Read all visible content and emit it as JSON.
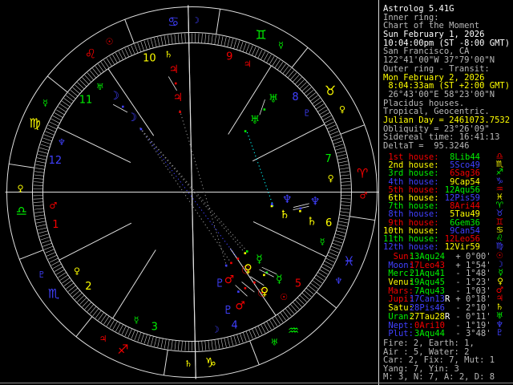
{
  "app_title": "Astrolog 5.41G",
  "colors": {
    "red": "#f40000",
    "yellow": "#ffff00",
    "green": "#00f000",
    "blue": "#4040ff",
    "cyan": "#00ffff",
    "gray": "#b8b8b8",
    "white": "#ffffff",
    "wheel_line": "#e0e0e0",
    "tick": "#c8c8c8",
    "aspect_gray": "#8f8f8f",
    "leader": "#e8e8e8"
  },
  "panel": {
    "info_lines": [
      {
        "text": "Astrolog 5.41G",
        "color": "white"
      },
      {
        "text": "Inner ring:",
        "color": "gray"
      },
      {
        "text": "Chart of the Moment",
        "color": "gray"
      },
      {
        "text": "Sun February 1, 2026",
        "color": "white"
      },
      {
        "text": "10:04:00pm (ST -8:00 GMT)",
        "color": "white"
      },
      {
        "text": "San Francisco, CA",
        "color": "gray"
      },
      {
        "text": "122°41'00\"W 37°79'00\"N",
        "color": "gray"
      },
      {
        "text": "Outer ring - Transit:",
        "color": "gray"
      },
      {
        "text": "Mon February 2, 2026",
        "color": "yellow"
      },
      {
        "text": " 8:04:33am (ST +2:00 GMT)",
        "color": "yellow"
      },
      {
        "text": " 26°43'00\"E 58°23'00\"N",
        "color": "gray"
      },
      {
        "text": "Placidus houses.",
        "color": "gray"
      },
      {
        "text": "Tropical, Geocentric.",
        "color": "gray"
      },
      {
        "text": "Julian Day = 2461073.7532",
        "color": "yellow"
      },
      {
        "text": "Obliquity = 23°26'09\"",
        "color": "gray"
      },
      {
        "text": "Sidereal time: 16:41:13",
        "color": "gray"
      },
      {
        "text": "DeltaT =  95.3246",
        "color": "gray"
      }
    ],
    "stats_lines": [
      "Fire: 2, Earth: 1,",
      "Air : 5, Water: 2",
      "Car: 2, Fix: 7, Mut: 1",
      "Yang: 7, Yin: 3",
      "M: 3, N: 7, A: 2, D: 8"
    ]
  },
  "houses": [
    {
      "num": "1",
      "label": " 1st house:",
      "value": "8Lib44",
      "lon": 188.73,
      "sign_glyph": "♎",
      "label_color": "red",
      "value_color": "green",
      "glyph_color": "red",
      "natural_ruler": "♂",
      "ruler_color": "red"
    },
    {
      "num": "2",
      "label": " 2nd house:",
      "value": "5Sco49",
      "lon": 215.82,
      "sign_glyph": "♏",
      "label_color": "yellow",
      "value_color": "blue",
      "glyph_color": "yellow",
      "natural_ruler": "♀",
      "ruler_color": "yellow"
    },
    {
      "num": "3",
      "label": " 3rd house:",
      "value": "6Sag36",
      "lon": 246.6,
      "sign_glyph": "♐",
      "label_color": "green",
      "value_color": "red",
      "glyph_color": "green",
      "natural_ruler": "☿",
      "ruler_color": "green"
    },
    {
      "num": "4",
      "label": " 4th house:",
      "value": "9Cap54",
      "lon": 279.9,
      "sign_glyph": "♑",
      "label_color": "blue",
      "value_color": "yellow",
      "glyph_color": "blue",
      "natural_ruler": "☽",
      "ruler_color": "blue"
    },
    {
      "num": "5",
      "label": " 5th house:",
      "value": "12Aqu56",
      "lon": 312.93,
      "sign_glyph": "♒",
      "label_color": "red",
      "value_color": "green",
      "glyph_color": "red",
      "natural_ruler": "☉",
      "ruler_color": "red"
    },
    {
      "num": "6",
      "label": " 6th house:",
      "value": "12Pis59",
      "lon": 342.98,
      "sign_glyph": "♓",
      "label_color": "yellow",
      "value_color": "blue",
      "glyph_color": "yellow",
      "natural_ruler": "☿",
      "ruler_color": "green"
    },
    {
      "num": "7",
      "label": " 7th house:",
      "value": "8Ari44",
      "lon": 8.73,
      "sign_glyph": "♈",
      "label_color": "green",
      "value_color": "red",
      "glyph_color": "green",
      "natural_ruler": "♀",
      "ruler_color": "yellow"
    },
    {
      "num": "8",
      "label": " 8th house:",
      "value": "5Tau49",
      "lon": 35.82,
      "sign_glyph": "♉",
      "label_color": "blue",
      "value_color": "yellow",
      "glyph_color": "blue",
      "natural_ruler": "♇",
      "ruler_color": "blue"
    },
    {
      "num": "9",
      "label": " 9th house:",
      "value": "6Gem36",
      "lon": 66.6,
      "sign_glyph": "♊",
      "label_color": "red",
      "value_color": "green",
      "glyph_color": "red",
      "natural_ruler": "♃",
      "ruler_color": "red"
    },
    {
      "num": "10",
      "label": "10th house:",
      "value": "9Can54",
      "lon": 99.9,
      "sign_glyph": "♋",
      "label_color": "yellow",
      "value_color": "blue",
      "glyph_color": "yellow",
      "natural_ruler": "♄",
      "ruler_color": "yellow"
    },
    {
      "num": "11",
      "label": "11th house:",
      "value": "12Leo56",
      "lon": 132.93,
      "sign_glyph": "♌",
      "label_color": "green",
      "value_color": "red",
      "glyph_color": "green",
      "natural_ruler": "♅",
      "ruler_color": "green"
    },
    {
      "num": "12",
      "label": "12th house:",
      "value": "12Vir59",
      "lon": 162.98,
      "sign_glyph": "♍",
      "label_color": "blue",
      "value_color": "yellow",
      "glyph_color": "blue",
      "natural_ruler": "♆",
      "ruler_color": "blue"
    }
  ],
  "planets": [
    {
      "name": "Sun",
      "label": "  Sun:",
      "value": "13Aqu24",
      "retro": " ",
      "vel": "+ 0°00'",
      "glyph": "☉",
      "color": "red",
      "value_color": "green",
      "lon": 313.4,
      "nudge": 0
    },
    {
      "name": "Moon",
      "label": " Moon:",
      "value": "17Leo43",
      "retro": " ",
      "vel": "+ 1°54'",
      "glyph": "☽",
      "color": "blue",
      "value_color": "red",
      "lon": 137.72,
      "nudge": 0
    },
    {
      "name": "Mercury",
      "label": " Merc:",
      "value": "21Aqu41",
      "retro": " ",
      "vel": "- 1°48'",
      "glyph": "☿",
      "color": "green",
      "value_color": "green",
      "lon": 321.68,
      "nudge": 2
    },
    {
      "name": "Venus",
      "label": " Venu:",
      "value": "19Aqu45",
      "retro": " ",
      "vel": "- 1°23'",
      "glyph": "♀",
      "color": "yellow",
      "value_color": "green",
      "lon": 319.75,
      "nudge": -5
    },
    {
      "name": "Mars",
      "label": " Mars:",
      "value": " 7Aqu43",
      "retro": " ",
      "vel": "- 1°03'",
      "glyph": "♂",
      "color": "red",
      "value_color": "green",
      "lon": 307.72,
      "nudge": -6
    },
    {
      "name": "Jupiter",
      "label": " Jupi:",
      "value": "17Can13",
      "retro": "R",
      "vel": "+ 0°18'",
      "glyph": "♃",
      "color": "red",
      "value_color": "blue",
      "lon": 107.22,
      "nudge": 0
    },
    {
      "name": "Saturn",
      "label": " Satu:",
      "value": "28Pis46",
      "retro": " ",
      "vel": "- 2°10'",
      "glyph": "♄",
      "color": "yellow",
      "value_color": "blue",
      "lon": 358.77,
      "nudge": -4
    },
    {
      "name": "Uranus",
      "label": " Uran:",
      "value": "27Tau28",
      "retro": "R",
      "vel": "- 0°11'",
      "glyph": "♅",
      "color": "green",
      "value_color": "yellow",
      "lon": 57.47,
      "nudge": 0
    },
    {
      "name": "Neptune",
      "label": " Nept:",
      "value": " 0Ari10",
      "retro": " ",
      "vel": "- 1°19'",
      "glyph": "♆",
      "color": "blue",
      "value_color": "red",
      "lon": 0.17,
      "nudge": 4
    },
    {
      "name": "Pluto",
      "label": " Plut:",
      "value": " 3Aqu44",
      "retro": " ",
      "vel": "- 3°48'",
      "glyph": "♇",
      "color": "blue",
      "value_color": "green",
      "lon": 303.73,
      "nudge": -8
    }
  ],
  "signs": [
    {
      "name": "Aries",
      "glyph": "♈",
      "color": "red",
      "ruler": "♂",
      "ruler_color": "red"
    },
    {
      "name": "Taurus",
      "glyph": "♉",
      "color": "yellow",
      "ruler": "♀",
      "ruler_color": "yellow"
    },
    {
      "name": "Gemini",
      "glyph": "♊",
      "color": "green",
      "ruler": "☿",
      "ruler_color": "green"
    },
    {
      "name": "Cancer",
      "glyph": "♋",
      "color": "blue",
      "ruler": "☽",
      "ruler_color": "blue"
    },
    {
      "name": "Leo",
      "glyph": "♌",
      "color": "red",
      "ruler": "☉",
      "ruler_color": "red"
    },
    {
      "name": "Virgo",
      "glyph": "♍",
      "color": "yellow",
      "ruler": "☿",
      "ruler_color": "green"
    },
    {
      "name": "Libra",
      "glyph": "♎",
      "color": "green",
      "ruler": "♀",
      "ruler_color": "yellow"
    },
    {
      "name": "Scorpio",
      "glyph": "♏",
      "color": "blue",
      "ruler": "♇",
      "ruler_color": "blue"
    },
    {
      "name": "Sagittarius",
      "glyph": "♐",
      "color": "red",
      "ruler": "♃",
      "ruler_color": "red"
    },
    {
      "name": "Capricorn",
      "glyph": "♑",
      "color": "yellow",
      "ruler": "♄",
      "ruler_color": "yellow"
    },
    {
      "name": "Aquarius",
      "glyph": "♒",
      "color": "green",
      "ruler": "♅",
      "ruler_color": "green"
    },
    {
      "name": "Pisces",
      "glyph": "♓",
      "color": "blue",
      "ruler": "♆",
      "ruler_color": "blue"
    }
  ],
  "wheel": {
    "ascendant_lon": 188.73,
    "aspects": [
      {
        "a": "Moon",
        "b": "Sun",
        "color": "blue"
      },
      {
        "a": "Moon",
        "b": "Venus",
        "color": "aspect_gray"
      },
      {
        "a": "Moon",
        "b": "Mercury",
        "color": "aspect_gray"
      },
      {
        "a": "Moon",
        "b": "Mars",
        "color": "aspect_gray"
      },
      {
        "a": "Jupiter",
        "b": "Pluto",
        "color": "aspect_gray"
      },
      {
        "a": "Saturn",
        "b": "Uranus",
        "color": "cyan"
      }
    ]
  }
}
